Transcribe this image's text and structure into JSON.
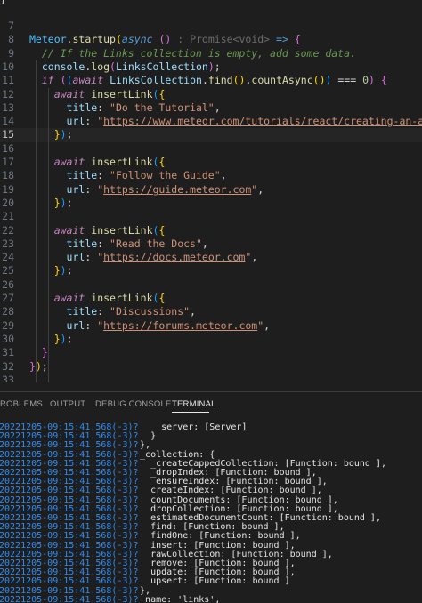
{
  "editor": {
    "top_fragment": "}",
    "lines": [
      {
        "n": "7",
        "tokens": []
      },
      {
        "n": "8",
        "tokens": [
          [
            "c-ident",
            "Meteor"
          ],
          [
            "c-punct",
            "."
          ],
          [
            "c-func",
            "startup"
          ],
          [
            "c-paren",
            "("
          ],
          [
            "c-kw2",
            "async"
          ],
          [
            "c-plain",
            " "
          ],
          [
            "c-brace",
            "()"
          ],
          [
            "c-hint",
            " : Promise<void>"
          ],
          [
            "c-plain",
            " "
          ],
          [
            "c-kw2",
            "=>"
          ],
          [
            "c-plain",
            " "
          ],
          [
            "c-brace",
            "{"
          ]
        ]
      },
      {
        "n": "9",
        "tokens": [
          [
            "c-com",
            "  // If the Links collection is empty, add some data."
          ]
        ]
      },
      {
        "n": "10",
        "tokens": [
          [
            "c-plain",
            "  "
          ],
          [
            "c-var",
            "console"
          ],
          [
            "c-punct",
            "."
          ],
          [
            "c-func",
            "log"
          ],
          [
            "c-brace",
            "("
          ],
          [
            "c-var",
            "LinksCollection"
          ],
          [
            "c-brace",
            ")"
          ],
          [
            "c-punct",
            ";"
          ]
        ]
      },
      {
        "n": "11",
        "tokens": [
          [
            "c-plain",
            "  "
          ],
          [
            "c-kw",
            "if"
          ],
          [
            "c-plain",
            " "
          ],
          [
            "c-brace",
            "("
          ],
          [
            "c-brace2",
            "("
          ],
          [
            "c-kw",
            "await"
          ],
          [
            "c-plain",
            " "
          ],
          [
            "c-var",
            "LinksCollection"
          ],
          [
            "c-punct",
            "."
          ],
          [
            "c-func",
            "find"
          ],
          [
            "c-paren",
            "()"
          ],
          [
            "c-punct",
            "."
          ],
          [
            "c-func",
            "countAsync"
          ],
          [
            "c-paren",
            "()"
          ],
          [
            "c-brace2",
            ")"
          ],
          [
            "c-plain",
            " === "
          ],
          [
            "c-num",
            "0"
          ],
          [
            "c-brace",
            ")"
          ],
          [
            "c-plain",
            " "
          ],
          [
            "c-brace",
            "{"
          ]
        ]
      },
      {
        "n": "12",
        "tokens": [
          [
            "c-plain",
            "    "
          ],
          [
            "c-kw",
            "await"
          ],
          [
            "c-plain",
            " "
          ],
          [
            "c-func",
            "insertLink"
          ],
          [
            "c-brace2",
            "("
          ],
          [
            "c-paren",
            "{"
          ]
        ]
      },
      {
        "n": "13",
        "tokens": [
          [
            "c-plain",
            "      "
          ],
          [
            "c-var",
            "title"
          ],
          [
            "c-punct",
            ": "
          ],
          [
            "c-str",
            "\"Do the Tutorial\""
          ],
          [
            "c-punct",
            ","
          ]
        ]
      },
      {
        "n": "14",
        "tokens": [
          [
            "c-plain",
            "      "
          ],
          [
            "c-var",
            "url"
          ],
          [
            "c-punct",
            ": "
          ],
          [
            "c-str",
            "\""
          ],
          [
            "c-url",
            "https://www.meteor.com/tutorials/react/creating-an-app"
          ],
          [
            "c-str",
            "\""
          ]
        ]
      },
      {
        "n": "15",
        "tokens": [
          [
            "c-plain",
            "    "
          ],
          [
            "c-paren",
            "}"
          ],
          [
            "c-brace2",
            ")"
          ],
          [
            "c-punct",
            ";"
          ]
        ],
        "current": true
      },
      {
        "n": "16",
        "tokens": []
      },
      {
        "n": "17",
        "tokens": [
          [
            "c-plain",
            "    "
          ],
          [
            "c-kw",
            "await"
          ],
          [
            "c-plain",
            " "
          ],
          [
            "c-func",
            "insertLink"
          ],
          [
            "c-brace2",
            "("
          ],
          [
            "c-paren",
            "{"
          ]
        ]
      },
      {
        "n": "18",
        "tokens": [
          [
            "c-plain",
            "      "
          ],
          [
            "c-var",
            "title"
          ],
          [
            "c-punct",
            ": "
          ],
          [
            "c-str",
            "\"Follow the Guide\""
          ],
          [
            "c-punct",
            ","
          ]
        ]
      },
      {
        "n": "19",
        "tokens": [
          [
            "c-plain",
            "      "
          ],
          [
            "c-var",
            "url"
          ],
          [
            "c-punct",
            ": "
          ],
          [
            "c-str",
            "\""
          ],
          [
            "c-url",
            "https://guide.meteor.com"
          ],
          [
            "c-str",
            "\""
          ],
          [
            "c-punct",
            ","
          ]
        ]
      },
      {
        "n": "20",
        "tokens": [
          [
            "c-plain",
            "    "
          ],
          [
            "c-paren",
            "}"
          ],
          [
            "c-brace2",
            ")"
          ],
          [
            "c-punct",
            ";"
          ]
        ]
      },
      {
        "n": "21",
        "tokens": []
      },
      {
        "n": "22",
        "tokens": [
          [
            "c-plain",
            "    "
          ],
          [
            "c-kw",
            "await"
          ],
          [
            "c-plain",
            " "
          ],
          [
            "c-func",
            "insertLink"
          ],
          [
            "c-brace2",
            "("
          ],
          [
            "c-paren",
            "{"
          ]
        ]
      },
      {
        "n": "23",
        "tokens": [
          [
            "c-plain",
            "      "
          ],
          [
            "c-var",
            "title"
          ],
          [
            "c-punct",
            ": "
          ],
          [
            "c-str",
            "\"Read the Docs\""
          ],
          [
            "c-punct",
            ","
          ]
        ]
      },
      {
        "n": "24",
        "tokens": [
          [
            "c-plain",
            "      "
          ],
          [
            "c-var",
            "url"
          ],
          [
            "c-punct",
            ": "
          ],
          [
            "c-str",
            "\""
          ],
          [
            "c-url",
            "https://docs.meteor.com"
          ],
          [
            "c-str",
            "\""
          ],
          [
            "c-punct",
            ","
          ]
        ]
      },
      {
        "n": "25",
        "tokens": [
          [
            "c-plain",
            "    "
          ],
          [
            "c-paren",
            "}"
          ],
          [
            "c-brace2",
            ")"
          ],
          [
            "c-punct",
            ";"
          ]
        ]
      },
      {
        "n": "26",
        "tokens": []
      },
      {
        "n": "27",
        "tokens": [
          [
            "c-plain",
            "    "
          ],
          [
            "c-kw",
            "await"
          ],
          [
            "c-plain",
            " "
          ],
          [
            "c-func",
            "insertLink"
          ],
          [
            "c-brace2",
            "("
          ],
          [
            "c-paren",
            "{"
          ]
        ]
      },
      {
        "n": "28",
        "tokens": [
          [
            "c-plain",
            "      "
          ],
          [
            "c-var",
            "title"
          ],
          [
            "c-punct",
            ": "
          ],
          [
            "c-str",
            "\"Discussions\""
          ],
          [
            "c-punct",
            ","
          ]
        ]
      },
      {
        "n": "29",
        "tokens": [
          [
            "c-plain",
            "      "
          ],
          [
            "c-var",
            "url"
          ],
          [
            "c-punct",
            ": "
          ],
          [
            "c-str",
            "\""
          ],
          [
            "c-url",
            "https://forums.meteor.com"
          ],
          [
            "c-str",
            "\""
          ],
          [
            "c-punct",
            ","
          ]
        ]
      },
      {
        "n": "30",
        "tokens": [
          [
            "c-plain",
            "    "
          ],
          [
            "c-paren",
            "}"
          ],
          [
            "c-brace2",
            ")"
          ],
          [
            "c-punct",
            ";"
          ]
        ]
      },
      {
        "n": "31",
        "tokens": [
          [
            "c-plain",
            "  "
          ],
          [
            "c-brace",
            "}"
          ]
        ]
      },
      {
        "n": "32",
        "tokens": [
          [
            "c-brace",
            "}"
          ],
          [
            "c-paren",
            ")"
          ],
          [
            "c-punct",
            ";"
          ]
        ]
      },
      {
        "n": "33",
        "tokens": []
      }
    ]
  },
  "panel": {
    "tabs": [
      {
        "label": "ROBLEMS"
      },
      {
        "label": "OUTPUT"
      },
      {
        "label": "DEBUG CONSOLE"
      },
      {
        "label": "TERMINAL",
        "active": true
      }
    ]
  },
  "terminal": {
    "prefix_color": "#2f8cf2",
    "lines": [
      {
        "prefix": "20221205-09:15:41.568(-3)?",
        "text": "      server: [Server]"
      },
      {
        "prefix": "20221205-09:15:41.568(-3)?",
        "text": "    }"
      },
      {
        "prefix": "20221205-09:15:41.568(-3)?",
        "text": "  },"
      },
      {
        "prefix": "20221205-09:15:41.568(-3)?",
        "text": "  _collection: {"
      },
      {
        "prefix": "20221205-09:15:41.568(-3)?",
        "text": "    _createCappedCollection: [Function: bound ],"
      },
      {
        "prefix": "20221205-09:15:41.568(-3)?",
        "text": "    _dropIndex: [Function: bound ],"
      },
      {
        "prefix": "20221205-09:15:41.568(-3)?",
        "text": "    _ensureIndex: [Function: bound ],"
      },
      {
        "prefix": "20221205-09:15:41.568(-3)?",
        "text": "    createIndex: [Function: bound ],"
      },
      {
        "prefix": "20221205-09:15:41.568(-3)?",
        "text": "    countDocuments: [Function: bound ],"
      },
      {
        "prefix": "20221205-09:15:41.568(-3)?",
        "text": "    dropCollection: [Function: bound ],"
      },
      {
        "prefix": "20221205-09:15:41.568(-3)?",
        "text": "    estimatedDocumentCount: [Function: bound ],"
      },
      {
        "prefix": "20221205-09:15:41.568(-3)?",
        "text": "    find: [Function: bound ],"
      },
      {
        "prefix": "20221205-09:15:41.568(-3)?",
        "text": "    findOne: [Function: bound ],"
      },
      {
        "prefix": "20221205-09:15:41.568(-3)?",
        "text": "    insert: [Function: bound ],"
      },
      {
        "prefix": "20221205-09:15:41.568(-3)?",
        "text": "    rawCollection: [Function: bound ],"
      },
      {
        "prefix": "20221205-09:15:41.568(-3)?",
        "text": "    remove: [Function: bound ],"
      },
      {
        "prefix": "20221205-09:15:41.568(-3)?",
        "text": "    update: [Function: bound ],"
      },
      {
        "prefix": "20221205-09:15:41.568(-3)?",
        "text": "    upsert: [Function: bound ]"
      },
      {
        "prefix": "20221205-09:15:41.568(-3)?",
        "text": "  },"
      },
      {
        "prefix": "20221205-09:15:41.568(-3)?",
        "text": "  _name: 'links',"
      }
    ]
  }
}
